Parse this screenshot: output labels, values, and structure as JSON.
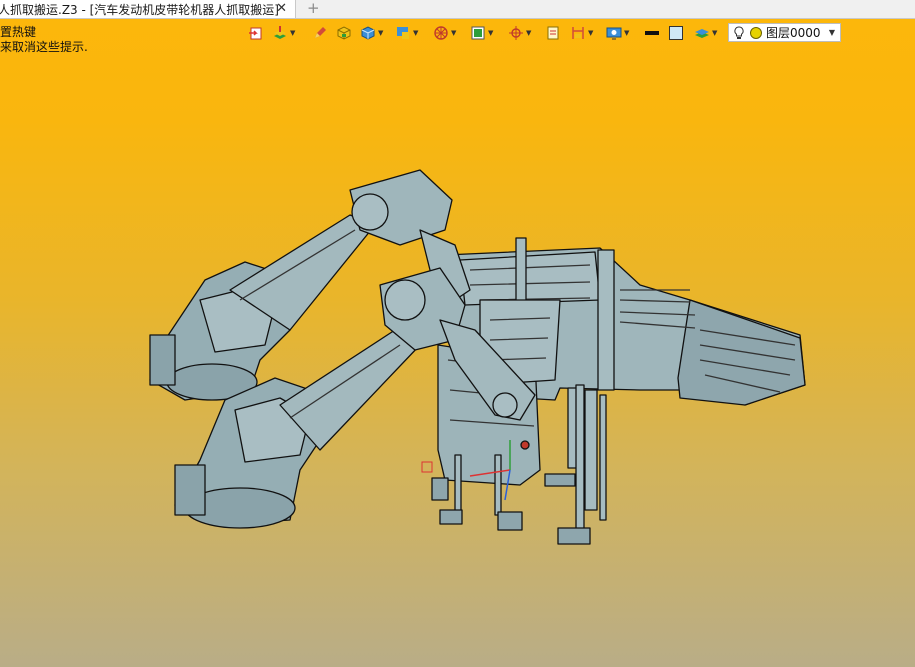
{
  "tab": {
    "title": "人抓取搬运.Z3 - [汽车发动机皮带轮机器人抓取搬运]",
    "close": "✕",
    "add": "+"
  },
  "hints": {
    "line1": "置热键",
    "line2": "来取消这些提示."
  },
  "toolbar": {
    "icons": [
      "import-icon",
      "layers-paint-icon",
      "pencil-icon",
      "solid-box-icon",
      "cube-view-icon",
      "display-mode-icon",
      "wheel-filter-icon",
      "frame-select-icon",
      "target-snap-icon",
      "sheet-icon",
      "dimension-icon",
      "monitor-icon",
      "line-color-swatch",
      "fill-color-swatch",
      "layer-stack-icon"
    ]
  },
  "layer": {
    "label": "图层0000",
    "bulb": "light-bulb-icon",
    "status_color": "#e6d200"
  },
  "colors": {
    "model": "#95aeb4",
    "model_dark": "#5f7880",
    "outline": "#111111",
    "bg_top": "#fdb70a",
    "bg_bottom": "#b9ad87"
  },
  "viewport": {
    "model_name": "robot-grab-assembly"
  }
}
